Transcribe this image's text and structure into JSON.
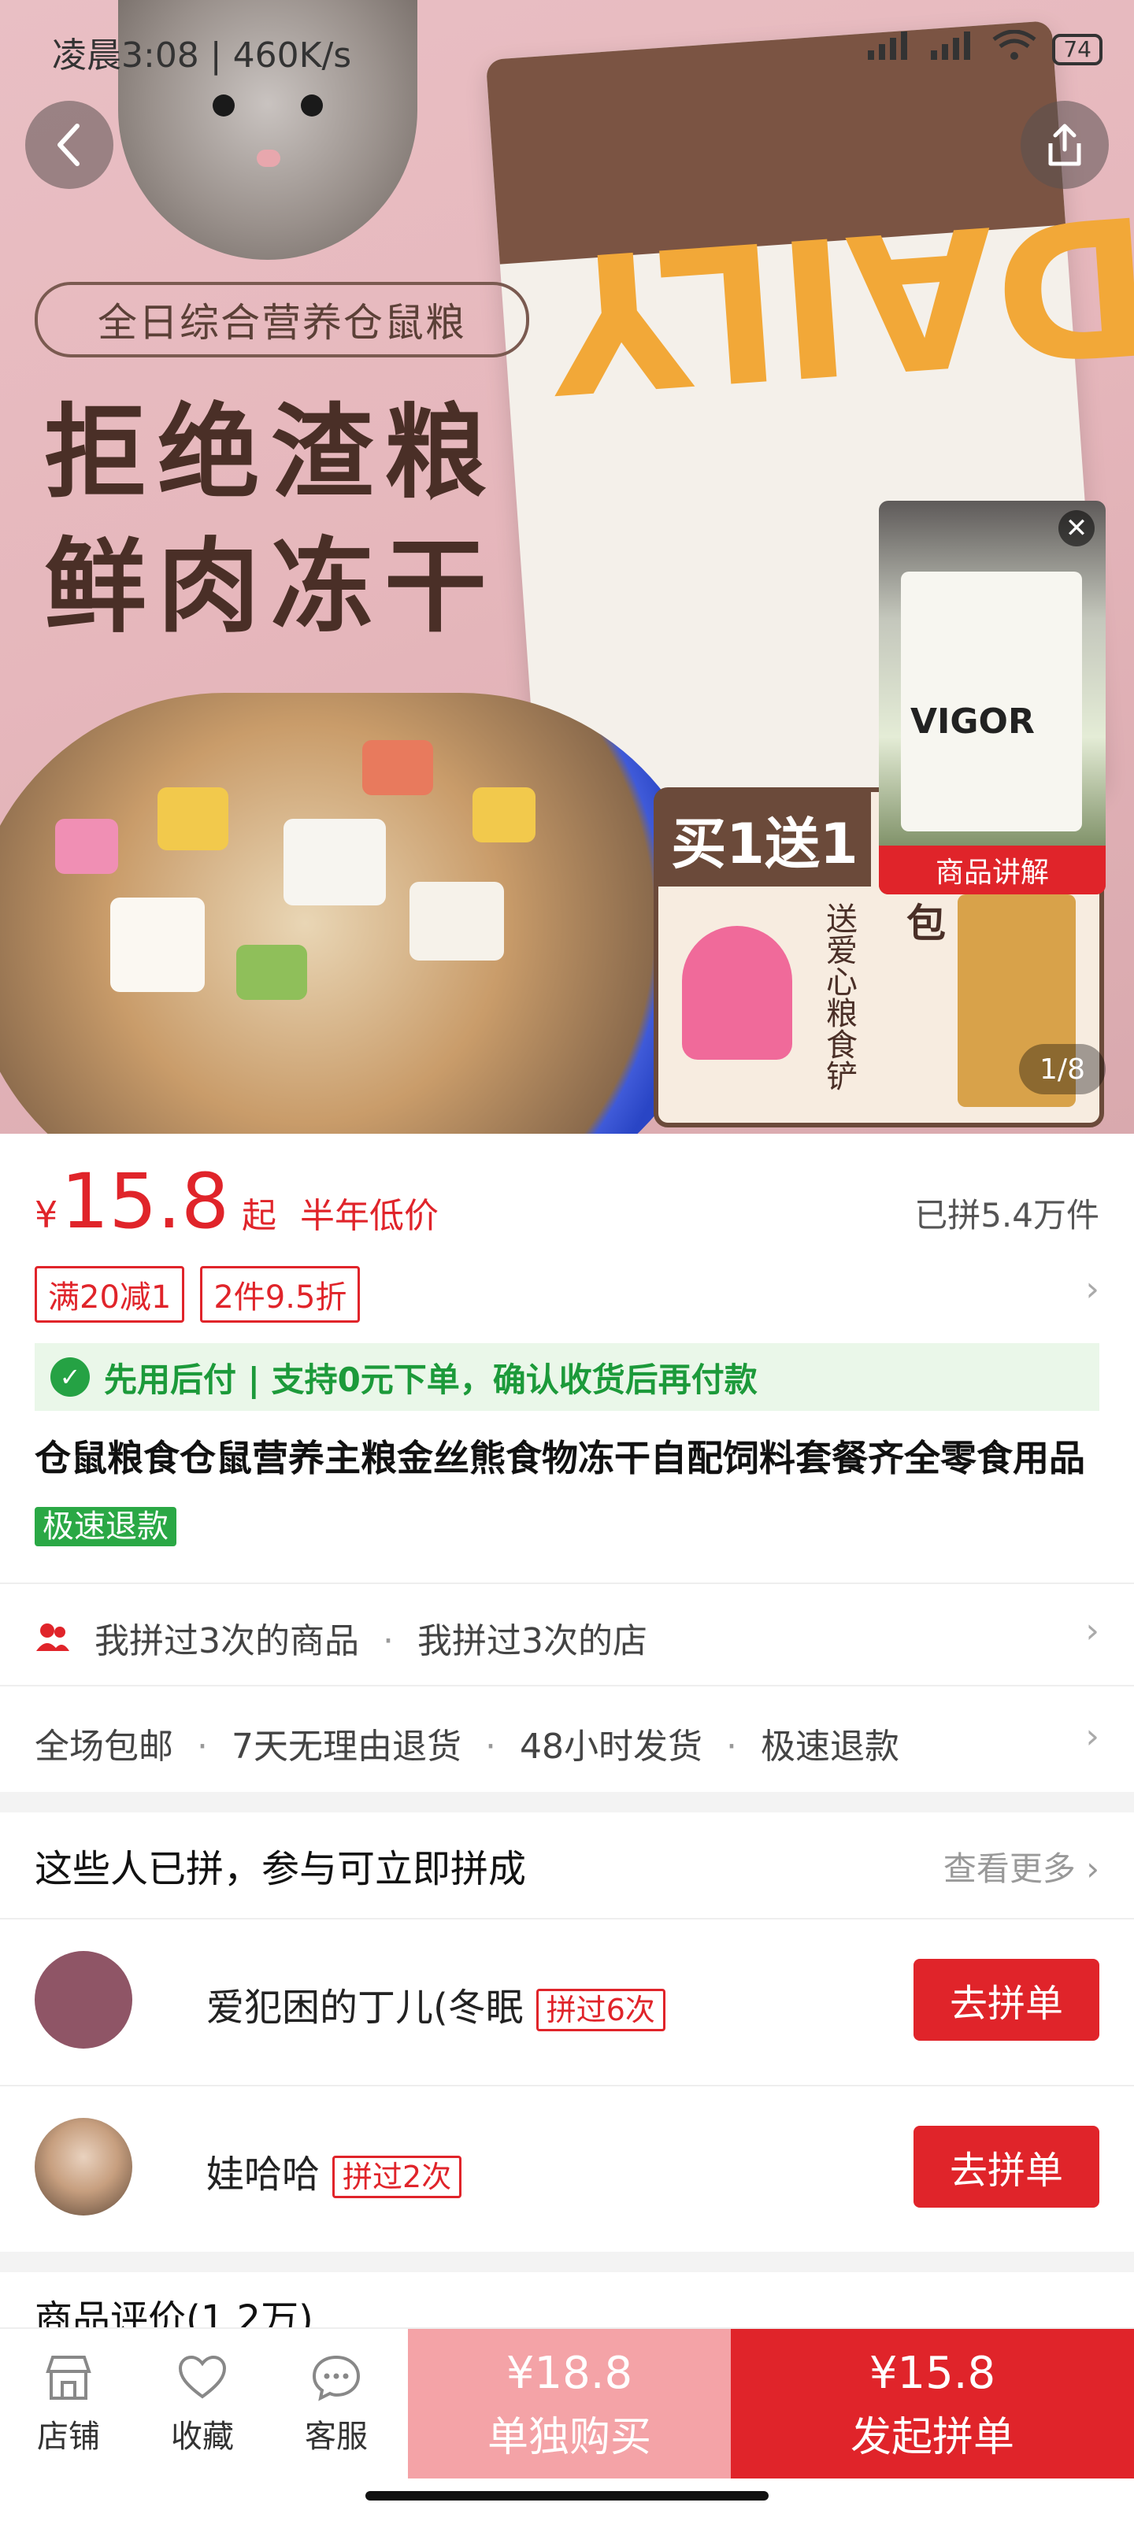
{
  "status_bar": {
    "time": "凌晨3:08 | 460K/s",
    "network": "HD",
    "battery": "74"
  },
  "hero": {
    "tag": "全日综合营养仓鼠粮",
    "headline_1": "拒绝渣粮",
    "headline_2": "鲜肉冻干",
    "bag_logo": "DAILY",
    "promo_label": "买1送1",
    "promo_left": "送爱心粮食铲",
    "promo_mid": "送面包虫一包",
    "pip_brand": "VIGOR",
    "pip_caption": "商品讲解",
    "image_counter": "1/8",
    "icons": [
      "back-icon",
      "share-icon",
      "close-icon"
    ]
  },
  "price": {
    "currency": "¥",
    "value": "15.8",
    "from": "起",
    "low_label": "半年低价",
    "sold": "已拼5.4万件"
  },
  "coupons": [
    "满20减1",
    "2件9.5折"
  ],
  "pay_later": "先用后付 | 支持0元下单，确认收货后再付款",
  "product_title": "仓鼠粮食仓鼠营养主粮金丝熊食物冻干自配饲料套餐齐全零食用品",
  "fast_refund_badge": "极速退款",
  "history": {
    "goods": "我拼过3次的商品",
    "shop": "我拼过3次的店"
  },
  "services": [
    "全场包邮",
    "7天无理由退货",
    "48小时发货",
    "极速退款"
  ],
  "groups": {
    "title": "这些人已拼，参与可立即拼成",
    "see_more": "查看更多",
    "items": [
      {
        "name": "爱犯困的丁儿(冬眠",
        "times": "拼过6次",
        "button": "去拼单"
      },
      {
        "name": "娃哈哈",
        "times": "拼过2次",
        "button": "去拼单"
      }
    ]
  },
  "reviews_peek": "商品评价(1.2万)",
  "bottom_nav": {
    "shop": "店铺",
    "favorite": "收藏",
    "service": "客服",
    "solo_price": "¥18.8",
    "solo_label": "单独购买",
    "group_price": "¥15.8",
    "group_label": "发起拼单"
  },
  "colors": {
    "accent": "#e0242a",
    "accent_light": "#f4a3a7",
    "green": "#25a244"
  }
}
